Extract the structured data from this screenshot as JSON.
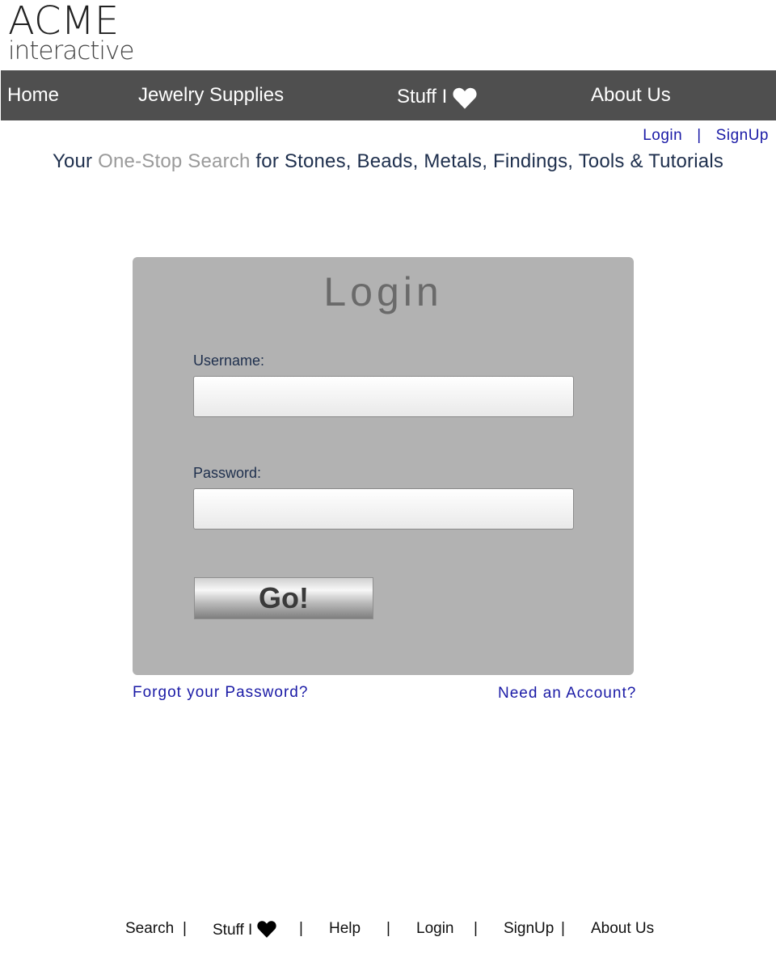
{
  "logo": {
    "line1": "ACME",
    "line2": "interactive"
  },
  "nav": {
    "home": "Home",
    "jewelry": "Jewelry Supplies",
    "stuff": "Stuff I",
    "about": "About Us",
    "icon": "heart-icon"
  },
  "auth": {
    "login": "Login",
    "separator": "|",
    "signup": "SignUp"
  },
  "tagline": {
    "prefix": "Your ",
    "highlight": "One-Stop Search",
    "suffix": " for Stones, Beads, Metals, Findings, Tools & Tutorials"
  },
  "login_form": {
    "title": "Login",
    "username_label": "Username:",
    "username_value": "",
    "password_label": "Password:",
    "password_value": "",
    "submit_label": "Go!",
    "forgot_link": "Forgot your Password?",
    "account_link": "Need an Account?"
  },
  "footer": {
    "search": "Search",
    "stuff": "Stuff I",
    "help": "Help",
    "login": "Login",
    "signup": "SignUp",
    "about": "About Us",
    "separator": "|"
  },
  "colors": {
    "nav_bg": "#4f4f4f",
    "panel_bg": "#b2b2b2",
    "link": "#1a1aa6",
    "tagline_text": "#1e2f4d",
    "tagline_highlight": "#9a9a9a"
  }
}
